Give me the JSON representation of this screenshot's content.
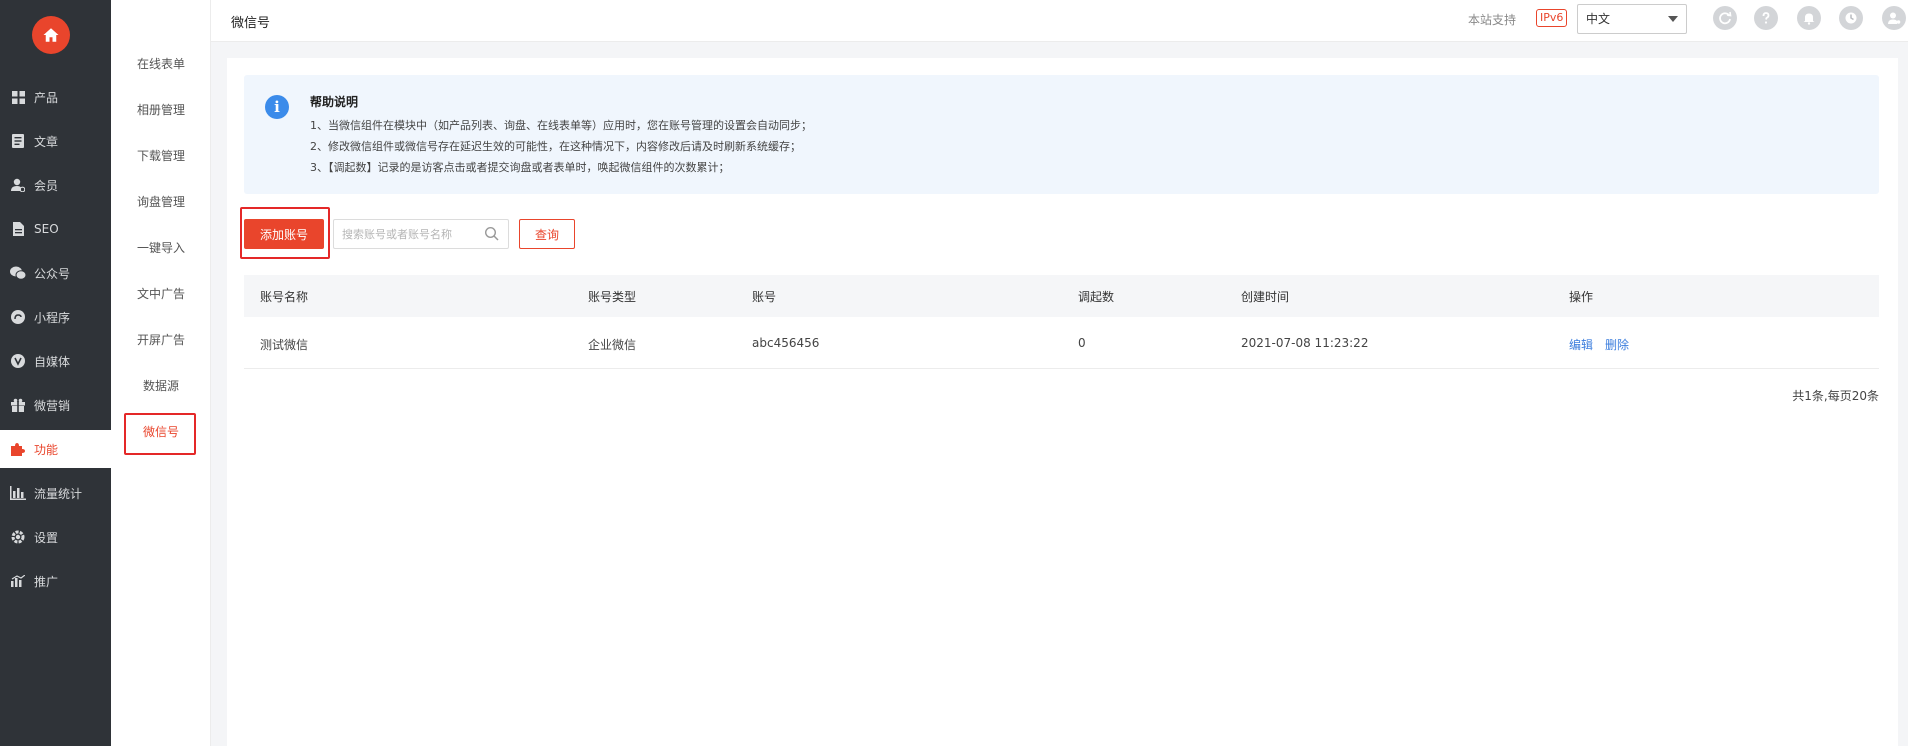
{
  "nav": {
    "items": [
      {
        "label": "产品",
        "icon": "grid-icon"
      },
      {
        "label": "文章",
        "icon": "article-icon"
      },
      {
        "label": "会员",
        "icon": "member-icon"
      },
      {
        "label": "SEO",
        "icon": "seo-icon"
      },
      {
        "label": "公众号",
        "icon": "wechat-icon"
      },
      {
        "label": "小程序",
        "icon": "mini-program-icon"
      },
      {
        "label": "自媒体",
        "icon": "media-icon"
      },
      {
        "label": "微营销",
        "icon": "gift-icon"
      },
      {
        "label": "功能",
        "icon": "puzzle-icon"
      },
      {
        "label": "流量统计",
        "icon": "chart-icon"
      },
      {
        "label": "设置",
        "icon": "gear-icon"
      },
      {
        "label": "推广",
        "icon": "promote-icon"
      }
    ],
    "active_index": 8
  },
  "subnav": {
    "items": [
      "在线表单",
      "相册管理",
      "下载管理",
      "询盘管理",
      "一键导入",
      "文中广告",
      "开屏广告",
      "数据源",
      "微信号"
    ],
    "active_index": 8
  },
  "header": {
    "title": "微信号",
    "support_text": "本站支持",
    "ipv6_badge": "IPv6",
    "language": "中文"
  },
  "help": {
    "title": "帮助说明",
    "lines": [
      "1、当微信组件在模块中（如产品列表、询盘、在线表单等）应用时，您在账号管理的设置会自动同步；",
      "2、修改微信组件或微信号存在延迟生效的可能性，在这种情况下，内容修改后请及时刷新系统缓存；",
      "3、【调起数】记录的是访客点击或者提交询盘或者表单时，唤起微信组件的次数累计；"
    ]
  },
  "toolbar": {
    "add_label": "添加账号",
    "search_placeholder": "搜索账号或者账号名称",
    "query_label": "查询"
  },
  "table": {
    "headers": [
      "账号名称",
      "账号类型",
      "账号",
      "调起数",
      "创建时间",
      "操作"
    ],
    "rows": [
      {
        "name": "测试微信",
        "type": "企业微信",
        "account": "abc456456",
        "calls": "0",
        "created": "2021-07-08 11:23:22",
        "edit": "编辑",
        "delete": "删除"
      }
    ]
  },
  "pager": {
    "text": "共1条,每页20条"
  },
  "colors": {
    "accent": "#e9452c",
    "sidebar_bg": "#2f3338",
    "link": "#3b7ddd",
    "help_bg": "#f0f6fd"
  }
}
